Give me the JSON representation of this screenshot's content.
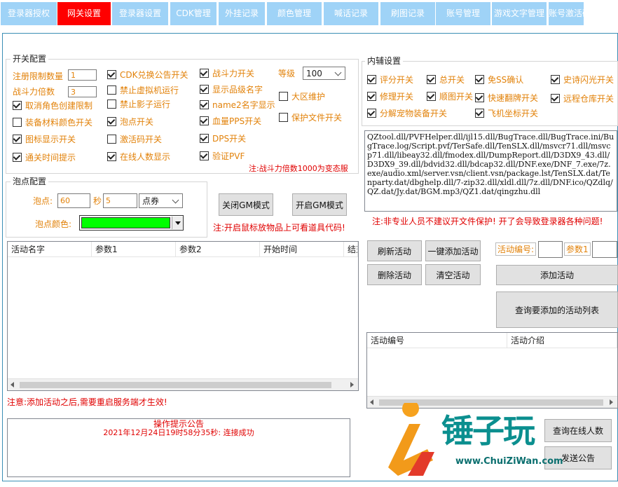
{
  "tabs": [
    {
      "label": "登录器授权",
      "active": false
    },
    {
      "label": "网关设置",
      "active": true
    },
    {
      "label": "登录器设置",
      "active": false
    },
    {
      "label": "CDK管理",
      "active": false
    },
    {
      "label": "外挂记录",
      "active": false
    },
    {
      "label": "颜色管理",
      "active": false
    },
    {
      "label": "喊话记录",
      "active": false
    },
    {
      "label": "刷图记录",
      "active": false
    },
    {
      "label": "账号管理",
      "active": false
    },
    {
      "label": "游戏文字管理",
      "active": false
    },
    {
      "label": "账号激活码",
      "active": false
    }
  ],
  "switch": {
    "title": "开关配置",
    "reg_limit_label": "注册限制数量",
    "reg_limit_value": "1",
    "power_mult_label": "战斗力倍数",
    "power_mult_value": "3",
    "level_label": "等级",
    "level_value": "100",
    "checkboxes": [
      {
        "label": "取消角色创建限制",
        "checked": true
      },
      {
        "label": "装备材料颜色开关",
        "checked": false
      },
      {
        "label": "图标显示开关",
        "checked": true
      },
      {
        "label": "通关时间提示",
        "checked": true
      },
      {
        "label": "CDK兑换公告开关",
        "checked": true
      },
      {
        "label": "禁止虚拟机运行",
        "checked": false
      },
      {
        "label": "禁止影子运行",
        "checked": false
      },
      {
        "label": "泡点开关",
        "checked": true
      },
      {
        "label": "激活码开关",
        "checked": false
      },
      {
        "label": "在线人数显示",
        "checked": true
      },
      {
        "label": "战斗力开关",
        "checked": true
      },
      {
        "label": "显示品级名字",
        "checked": true
      },
      {
        "label": "name2名字显示",
        "checked": true
      },
      {
        "label": "血量PPS开关",
        "checked": true
      },
      {
        "label": "DPS开关",
        "checked": true
      },
      {
        "label": "验证PVF",
        "checked": true
      },
      {
        "label": "大区维护",
        "checked": false
      },
      {
        "label": "保护文件开关",
        "checked": false
      }
    ],
    "note": "注:战斗力倍数1000为变态服"
  },
  "bubble": {
    "title": "泡点配置",
    "point_label": "泡点:",
    "point_value": "60",
    "sec_label": "秒",
    "sec_value": "5",
    "currency": "点券",
    "color_label": "泡点颜色:",
    "color": "#00ff00"
  },
  "gm": {
    "close_label": "关闭GM模式",
    "open_label": "开启GM模式",
    "note": "注:开启鼠标放物品上可看道具代码!"
  },
  "aux": {
    "title": "内辅设置",
    "checkboxes": [
      {
        "label": "评分开关",
        "checked": true
      },
      {
        "label": "总开关",
        "checked": true
      },
      {
        "label": "免SS确认",
        "checked": true
      },
      {
        "label": "史诗闪光开关",
        "checked": true
      },
      {
        "label": "修理开关",
        "checked": true
      },
      {
        "label": "顺图开关",
        "checked": true
      },
      {
        "label": "快速翻牌开关",
        "checked": true
      },
      {
        "label": "远程仓库开关",
        "checked": true
      },
      {
        "label": "分解宠物装备开关",
        "checked": true
      },
      {
        "label": "飞机坐标开关",
        "checked": true
      }
    ],
    "dll_text": "QZtool.dll/PVFHelper.dll/ijl15.dll/BugTrace.dll/BugTrace.ini/BugTrace.log/Script.pvf/TerSafe.dll/TenSLX.dll/msvcr71.dll/msvcp71.dll/libeay32.dll/fmodex.dll/DumpReport.dll/D3DX9_43.dll/D3DX9_39.dll/bdvid32.dll/bdcap32.dll/DNF.exe/DNF_7.exe/7z.exe/audio.xml/server.vsn/client.vsn/package.lst/TenSLX.dat/Tenparty.dat/dbghelp.dll/7-zip32.dll/xldl.dll/7z.dll/DNF.ico/QZdlq/QZ.dat/Jy.dat/BGM.mp3/QZ1.dat/qingzhu.dll",
    "warning": "注:非专业人员不建议开文件保护! 开了会导致登录器各种问题!"
  },
  "activity": {
    "columns": [
      "活动名字",
      "参数1",
      "参数2",
      "开始时间",
      "结束"
    ],
    "refresh_label": "刷新活动",
    "onekey_label": "一键添加活动",
    "delete_label": "删除活动",
    "clear_label": "清空活动",
    "id_label": "活动编号:",
    "param_label": "参数1",
    "add_label": "添加活动",
    "query_label": "查询要添加的活动列表",
    "list_columns": [
      "活动编号",
      "活动介绍"
    ],
    "note": "注意:添加活动之后,需要重启服务端才生效!"
  },
  "notice": {
    "title": "操作提示公告",
    "message": "2021年12月24日19时58分35秒: 连接成功"
  },
  "bottom": {
    "query_online_label": "查询在线人数",
    "send_label": "发送公告"
  },
  "watermark": {
    "brand": "锤子玩",
    "url": "www.ChuiZiWan.com"
  }
}
